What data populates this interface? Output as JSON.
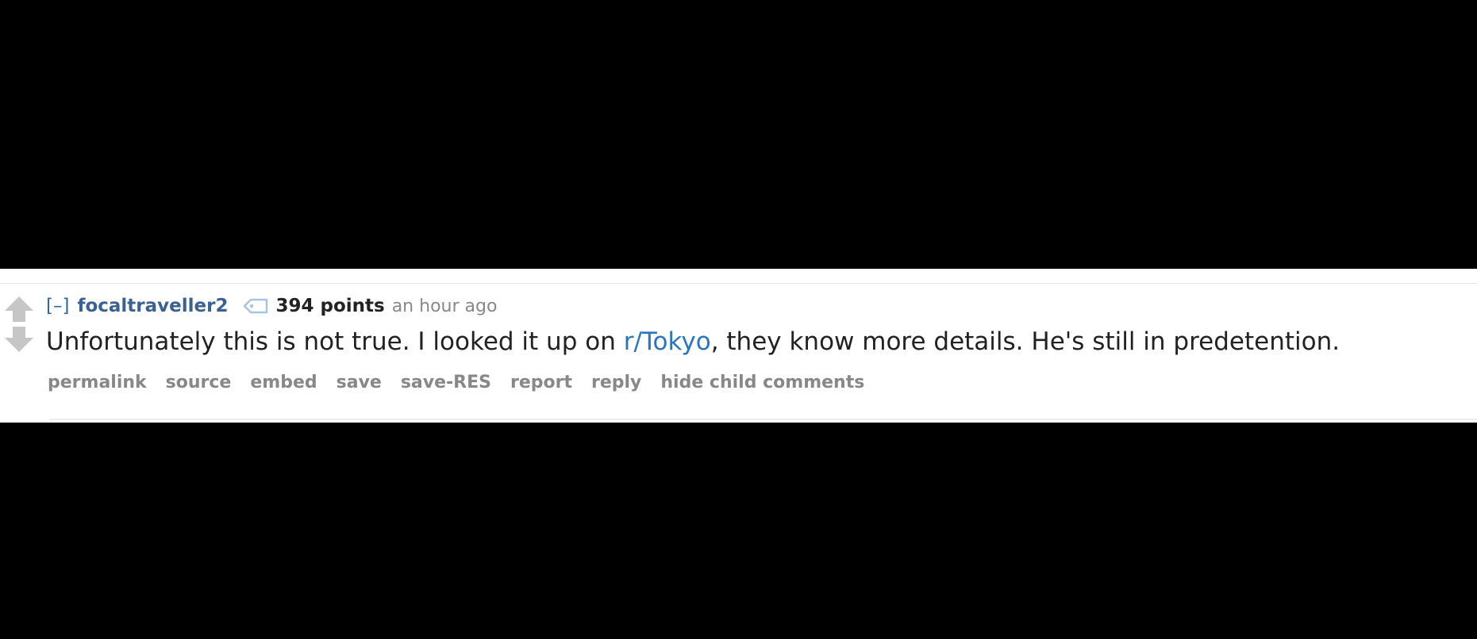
{
  "comment": {
    "expand_toggle": "[–]",
    "author": "focaltraveller2",
    "score": "394 points",
    "time": "an hour ago",
    "body": {
      "before_link": "Unfortunately this is not true. I looked it up on ",
      "link_text": "r/Tokyo",
      "after_link": ", they know more details. He's still in predetention."
    },
    "buttons": {
      "permalink": "permalink",
      "source": "source",
      "embed": "embed",
      "save": "save",
      "save_res": "save-RES",
      "report": "report",
      "reply": "reply",
      "hide_child": "hide child comments"
    },
    "icons": {
      "upvote": "upvote-arrow-icon",
      "downvote": "downvote-arrow-icon",
      "tag": "user-tag-icon"
    }
  },
  "colors": {
    "page_background": "#000000",
    "comment_background": "#ffffff",
    "author": "#3a6192",
    "link": "#2a75bf",
    "muted": "#888888",
    "arrow": "#c6c6c6"
  }
}
